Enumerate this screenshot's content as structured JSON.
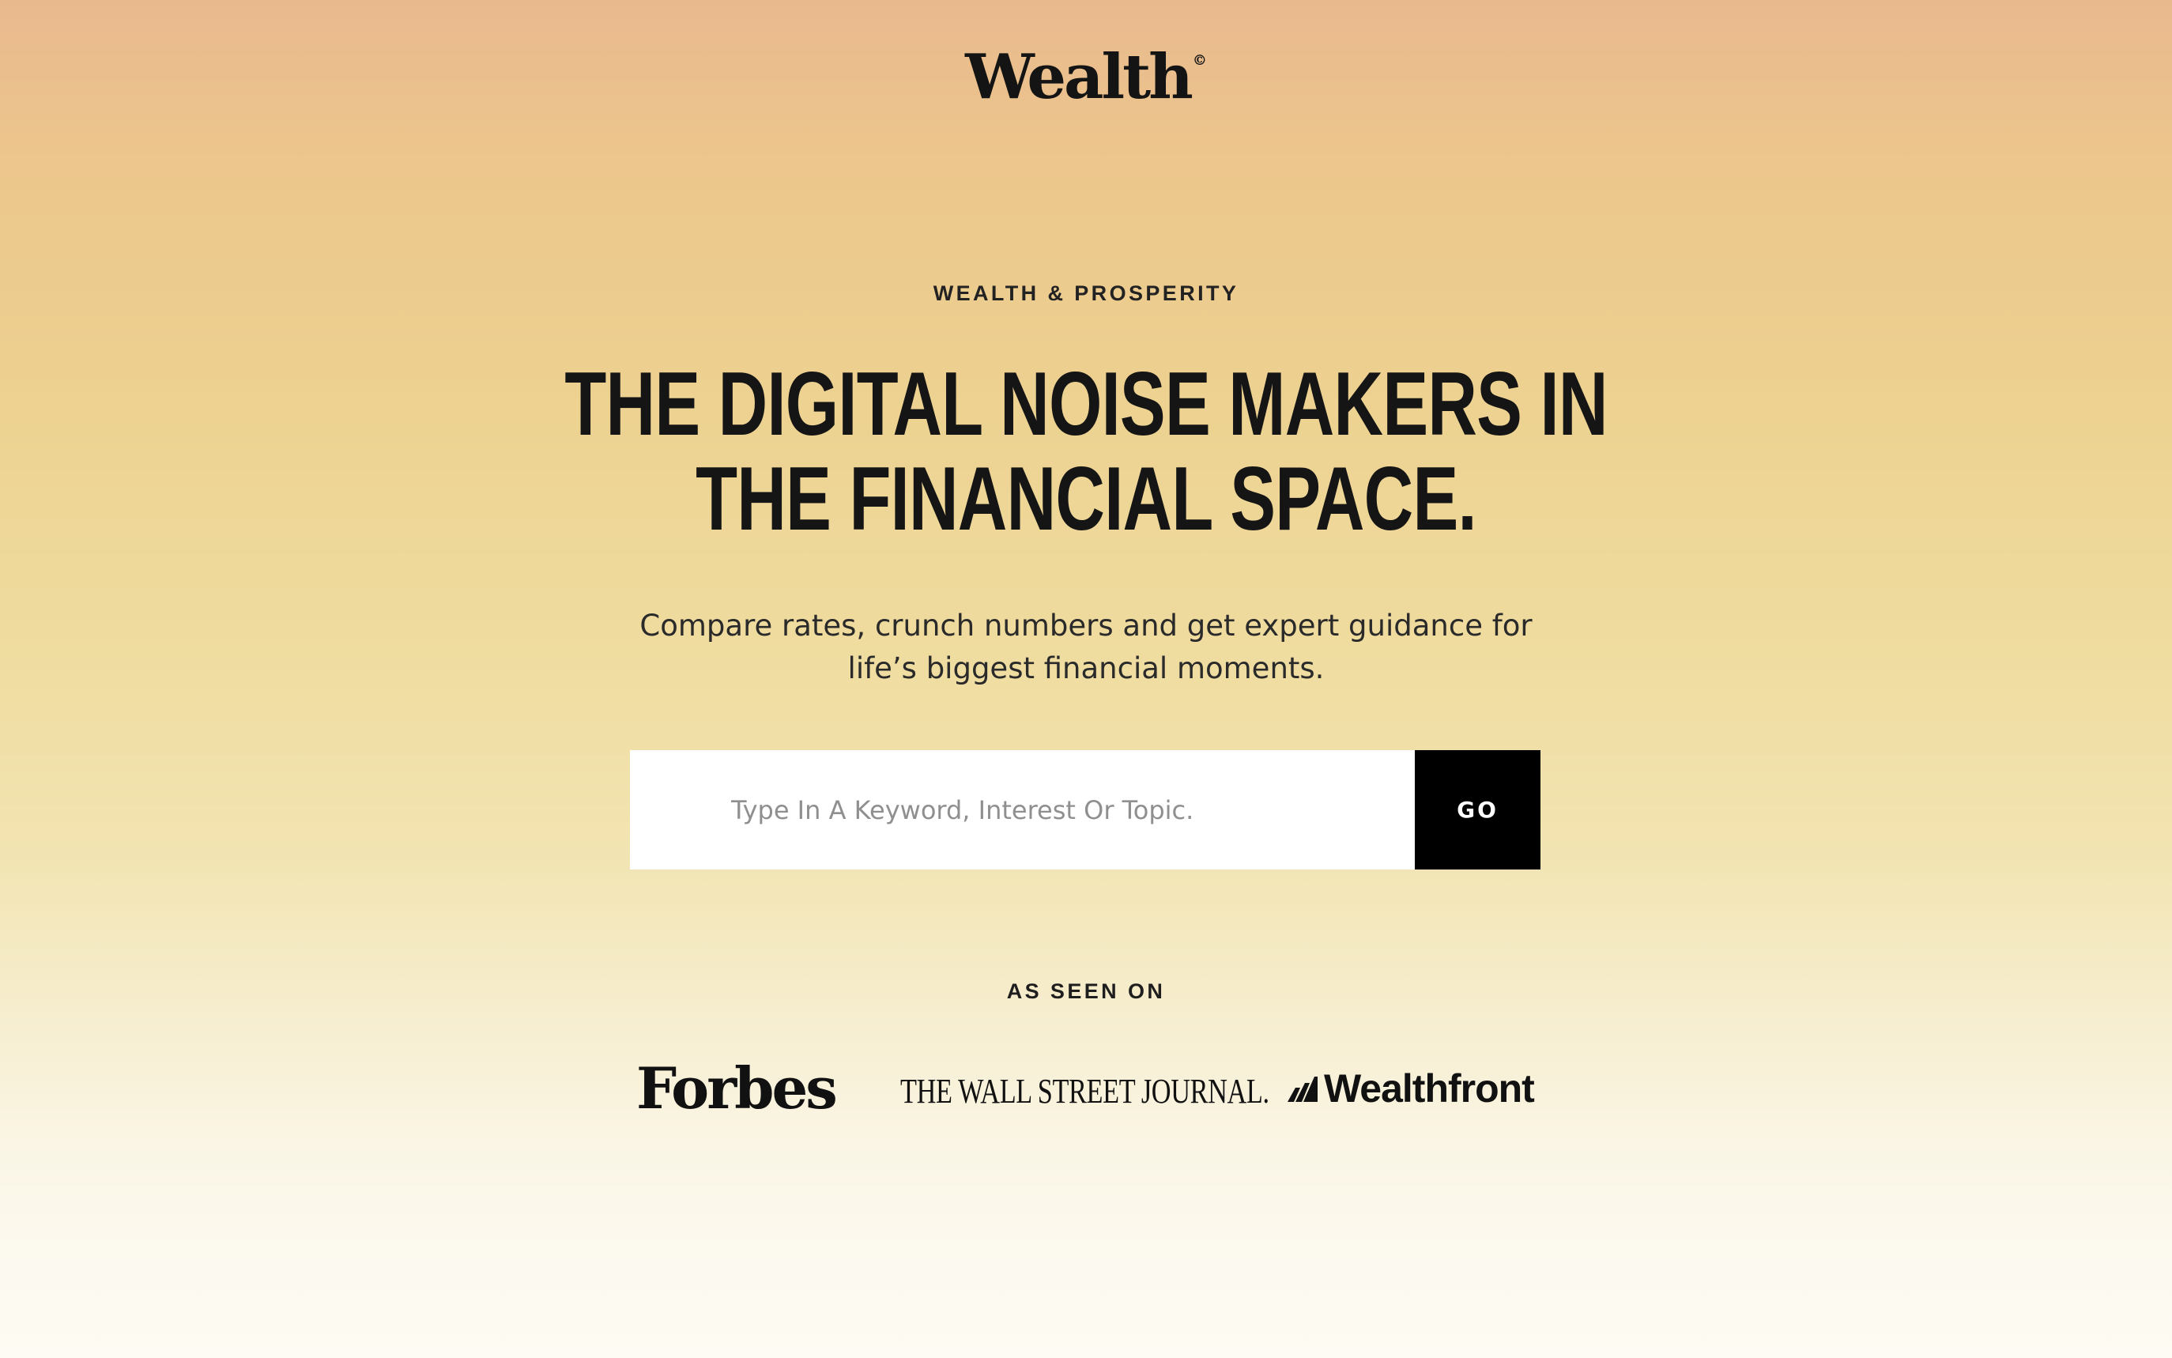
{
  "header": {
    "logo_text": "Wealth",
    "logo_mark": "©"
  },
  "hero": {
    "eyebrow": "WEALTH & PROSPERITY",
    "headline_line1": "THE DIGITAL NOISE MAKERS IN",
    "headline_line2": "THE FINANCIAL SPACE.",
    "subtext_line1": "Compare rates, crunch numbers and get expert guidance for",
    "subtext_line2": "life’s biggest financial moments."
  },
  "search": {
    "placeholder": "Type In A Keyword, Interest Or Topic.",
    "value": "",
    "button_label": "GO"
  },
  "press": {
    "label": "AS SEEN ON",
    "logos": [
      "Forbes",
      "THE WALL STREET JOURNAL.",
      "Wealthfront"
    ]
  },
  "colors": {
    "gradient_top": "#e9b98e",
    "gradient_bottom": "#fdfbf3",
    "button_bg": "#000000",
    "text": "#151515"
  }
}
